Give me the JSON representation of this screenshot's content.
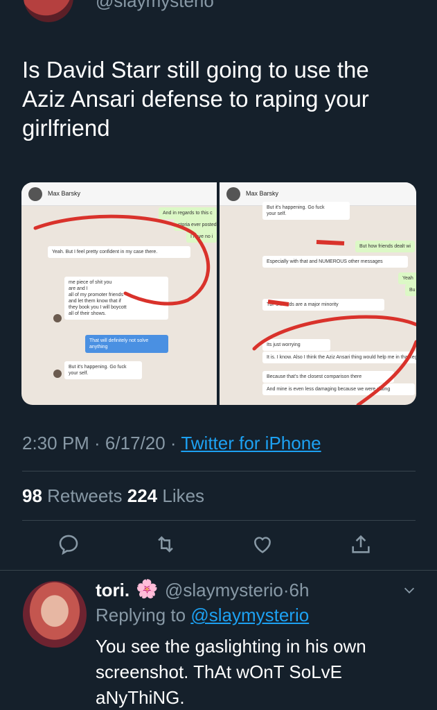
{
  "header": {
    "handle": "@slaymysterio"
  },
  "tweet": {
    "text": "Is David Starr still going to use the Aziz Ansari defense to raping your girlfriend",
    "time": "2:30 PM · 6/17/20 · ",
    "source": "Twitter for iPhone",
    "retweets": "98",
    "retweets_label": " Retweets  ",
    "likes": "224",
    "likes_label": " Likes"
  },
  "screenshot_left": {
    "contact": "Max Barsky",
    "msg1": "And in regards to this c",
    "msg2": "ctoria ever posted",
    "msg3": "I have no i",
    "msg4": "Yeah. But I feel pretty confident in my case there.",
    "msg5_l1": "me     piece of shit you",
    "msg5_l2": "are and I",
    "msg5_l3": "all of my promoter friends",
    "msg5_l4": "and let them know that if",
    "msg5_l5": "they book you I will boycott",
    "msg5_l6": "all of their shows.",
    "msg6_l1": "That will definitely not solve",
    "msg6_l2": "anything",
    "msg7_l1": "But it's happening. Go fuck",
    "msg7_l2": "your self."
  },
  "screenshot_right": {
    "contact": "Max Barsky",
    "msg1_l1": "But it's happening. Go fuck",
    "msg1_l2": "your self.",
    "msg2": "But how      friends dealt wi",
    "msg3": "Especially with that and NUMEROUS other messages",
    "msg4": "Yeah",
    "msg5": "Bu",
    "msg6": "Tbf        's friends are a major minority",
    "msg7": "Its just worrying",
    "msg8": "It is. I know. Also I think the Aziz Ansari thing would help me in that regar",
    "msg9": "Because that's the closest comparison there",
    "msg10": "And mine is even less damaging because we were dating"
  },
  "icons": [
    "reply-icon",
    "retweet-icon",
    "like-icon",
    "share-icon",
    "chevron-down-icon"
  ],
  "reply": {
    "name": "tori.",
    "flower": "🌸",
    "handle": "@slaymysterio",
    "time": "·6h",
    "replying_prefix": "Replying to ",
    "replying_to": "@slaymysterio",
    "text": "You see the gaslighting in his own screenshot. ThAt wOnT SoLvE aNyThiNG."
  },
  "colors": {
    "background": "#15202b",
    "accent": "#1da1f2",
    "muted": "#8899a6",
    "divider": "#38444d"
  }
}
